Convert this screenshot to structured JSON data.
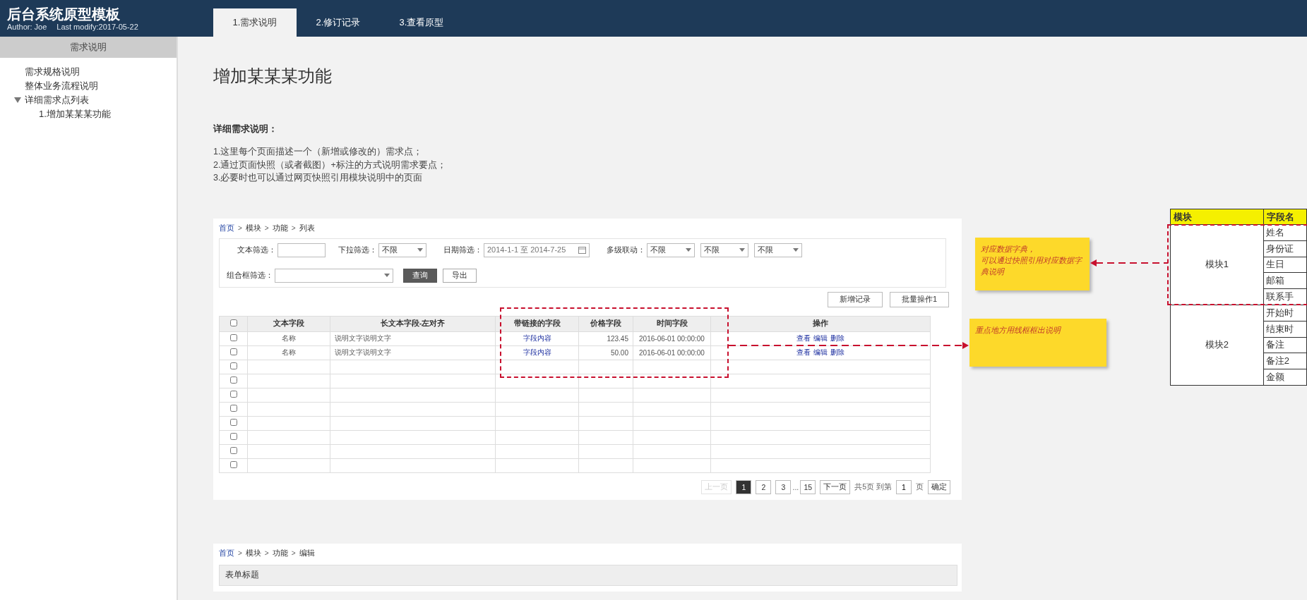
{
  "header": {
    "title": "后台系统原型模板",
    "author": "Author: Joe",
    "modified": "Last modify:2017-05-22"
  },
  "tabs": [
    {
      "label": "1.需求说明",
      "selected": true
    },
    {
      "label": "2.修订记录",
      "selected": false
    },
    {
      "label": "3.查看原型",
      "selected": false
    }
  ],
  "sidebar": {
    "heading": "需求说明",
    "items": [
      {
        "label": "需求规格说明"
      },
      {
        "label": "整体业务流程说明"
      },
      {
        "label": "详细需求点列表",
        "expanded": true,
        "children": [
          {
            "label": "1.增加某某某功能"
          }
        ]
      }
    ]
  },
  "page": {
    "title": "增加某某某功能",
    "section_heading": "详细需求说明：",
    "notes": [
      "1.这里每个页面描述一个（新增或修改的）需求点；",
      "2.通过页面快照（或者截图）+标注的方式说明需求要点；",
      "3.必要时也可以通过网页快照引用模块说明中的页面"
    ]
  },
  "list_card": {
    "breadcrumb": [
      {
        "label": "首页",
        "link": true
      },
      {
        "label": ">",
        "kind": "separator"
      },
      {
        "label": "模块",
        "link": false
      },
      {
        "label": ">",
        "kind": "separator"
      },
      {
        "label": "功能",
        "link": false
      },
      {
        "label": ">",
        "kind": "separator"
      },
      {
        "label": "列表",
        "link": false
      }
    ],
    "filters": [
      {
        "kind": "text",
        "label": "文本筛选："
      },
      {
        "kind": "select",
        "label": "下拉筛选：",
        "values": [
          "不限"
        ]
      },
      {
        "kind": "date",
        "label": "日期筛选：",
        "value": "2014-1-1 至 2014-7-25"
      },
      {
        "kind": "select",
        "label": "多级联动：",
        "values": [
          "不限",
          "不限",
          "不限"
        ]
      },
      {
        "kind": "combo",
        "label": "组合框筛选："
      }
    ],
    "filter_buttons": [
      {
        "label": "查询",
        "primary": true
      },
      {
        "label": "导出",
        "primary": false
      }
    ],
    "actions": [
      "新增记录",
      "批量操作1"
    ],
    "columns": [
      "文本字段",
      "长文本字段-左对齐",
      "带链接的字段",
      "价格字段",
      "时间字段",
      "操作"
    ],
    "header_checked": false,
    "rows": [
      {
        "checked": false,
        "cells": [
          "名称",
          "说明文字说明文字",
          "字段内容",
          "123.45",
          "2016-06-01 00:00:00"
        ],
        "ops": [
          "查看",
          "编辑",
          "删除"
        ]
      },
      {
        "checked": false,
        "cells": [
          "名称",
          "说明文字说明文字",
          "字段内容",
          "50.00",
          "2016-06-01 00:00:00"
        ],
        "ops": [
          "查看",
          "编辑",
          "删除"
        ]
      },
      {
        "checked": false
      },
      {
        "checked": false
      },
      {
        "checked": false
      },
      {
        "checked": false
      },
      {
        "checked": false
      },
      {
        "checked": false
      },
      {
        "checked": false
      },
      {
        "checked": false
      }
    ],
    "pagination": {
      "prev": {
        "label": "上一页",
        "disabled": true
      },
      "pages": [
        {
          "label": "1",
          "selected": true
        },
        {
          "label": "2",
          "selected": false
        },
        {
          "label": "3",
          "selected": false
        },
        {
          "label": "...",
          "kind": "gap"
        },
        {
          "label": "15",
          "selected": false
        }
      ],
      "next": {
        "label": "下一页",
        "disabled": false
      },
      "summary": "共5页 到第",
      "page_input": "1",
      "page_unit": "页",
      "go": "确定"
    }
  },
  "annotations": [
    {
      "lines": [
        "对应数据字典，",
        "可以通过快照引用对应数据字典说明"
      ]
    },
    {
      "lines": [
        "重点地方用线框框出说明"
      ]
    }
  ],
  "dictionary": {
    "columns": [
      "模块",
      "字段名"
    ],
    "groups": [
      {
        "name": "模块1",
        "fields": [
          "姓名",
          "身份证",
          "生日",
          "邮箱",
          "联系手"
        ]
      },
      {
        "name": "模块2",
        "fields": [
          "开始时",
          "结束时",
          "备注",
          "备注2",
          "金额"
        ]
      }
    ]
  },
  "edit_card": {
    "breadcrumb": [
      {
        "label": "首页",
        "link": true
      },
      {
        "label": ">",
        "kind": "separator"
      },
      {
        "label": "模块",
        "link": false
      },
      {
        "label": ">",
        "kind": "separator"
      },
      {
        "label": "功能",
        "link": false
      },
      {
        "label": ">",
        "kind": "separator"
      },
      {
        "label": "编辑",
        "link": false
      }
    ],
    "form_title": "表单标题"
  }
}
